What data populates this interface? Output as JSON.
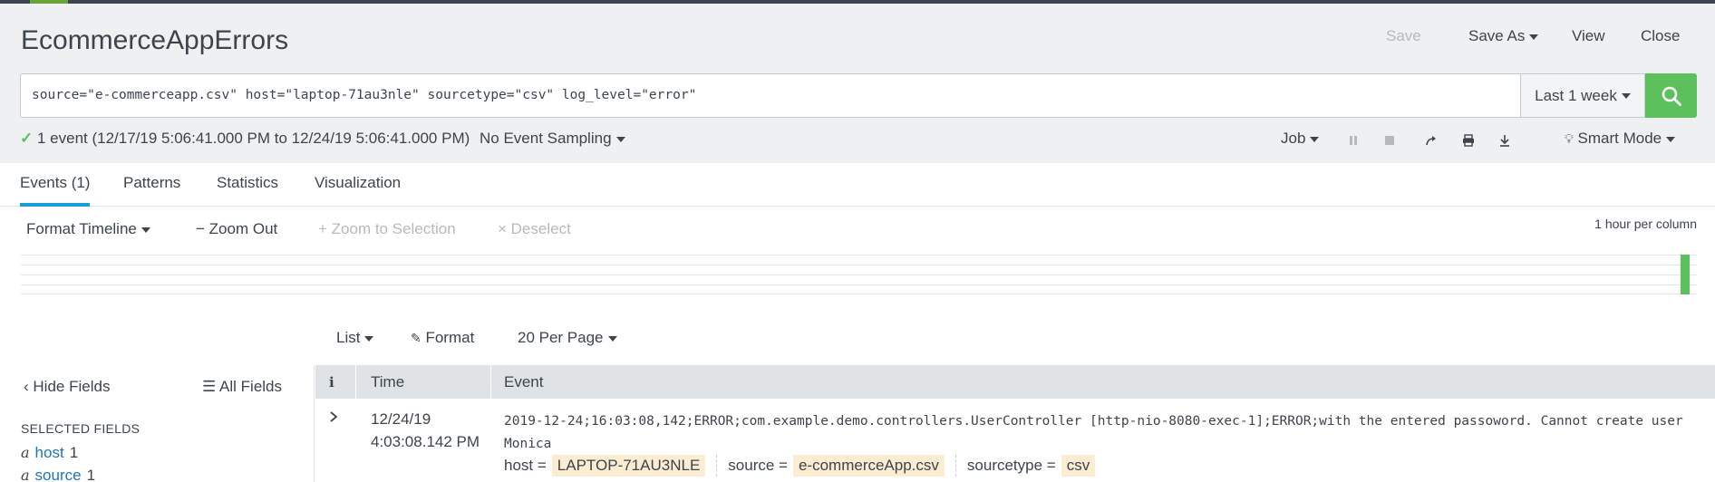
{
  "report": {
    "title": "EcommerceAppErrors",
    "actions": {
      "save": "Save",
      "save_as": "Save As",
      "view": "View",
      "close": "Close"
    }
  },
  "search": {
    "query": "source=\"e-commerceapp.csv\" host=\"laptop-71au3nle\" sourcetype=\"csv\" log_level=\"error\"",
    "time_range": "Last 1 week",
    "go_icon": "search-icon"
  },
  "status": {
    "summary": "1 event (12/17/19 5:06:41.000 PM to 12/24/19 5:06:41.000 PM)",
    "sampling": "No Event Sampling",
    "job": "Job",
    "mode": "Smart Mode"
  },
  "tabs": [
    {
      "label": "Events (1)",
      "active": true
    },
    {
      "label": "Patterns",
      "active": false
    },
    {
      "label": "Statistics",
      "active": false
    },
    {
      "label": "Visualization",
      "active": false
    }
  ],
  "timeline": {
    "format": "Format Timeline",
    "zoom_out": "Zoom Out",
    "zoom_to_selection": "+ Zoom to Selection",
    "deselect": "× Deselect",
    "resolution": "1 hour per column"
  },
  "results_bar": {
    "view": "List",
    "format": "Format",
    "per_page": "20 Per Page"
  },
  "fields_pane": {
    "hide": "Hide Fields",
    "all": "All Fields",
    "selected_heading": "SELECTED FIELDS",
    "fields": [
      {
        "type": "a",
        "name": "host",
        "count": "1"
      },
      {
        "type": "a",
        "name": "source",
        "count": "1"
      }
    ]
  },
  "table": {
    "columns": {
      "info": "i",
      "time": "Time",
      "event": "Event"
    },
    "rows": [
      {
        "date": "12/24/19",
        "time": "4:03:08.142 PM",
        "event": "2019-12-24;16:03:08,142;ERROR;com.example.demo.controllers.UserController [http-nio-8080-exec-1];ERROR;with the entered passoword. Cannot create user Monica",
        "kv": [
          {
            "key": "host =",
            "value": "LAPTOP-71AU3NLE"
          },
          {
            "key": "source =",
            "value": "e-commerceApp.csv"
          },
          {
            "key": "sourcetype =",
            "value": "csv"
          }
        ]
      }
    ]
  },
  "colors": {
    "accent_green": "#5cc05c",
    "tab_underline": "#1a9cd6",
    "highlight": "#fcecd2",
    "link": "#1e73be"
  }
}
